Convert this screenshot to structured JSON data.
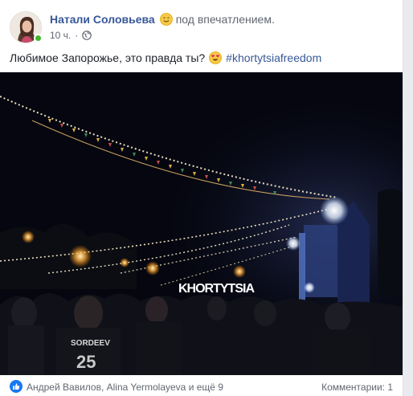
{
  "post": {
    "author": "Натали Соловьева",
    "feeling": "под впечатлением.",
    "time": "10 ч.",
    "separator": "·",
    "text": "Любимое Запорожье, это правда ты?",
    "hashtag": "#khortytsiafreedom",
    "photo_sign": "KHORTYTSIA"
  },
  "reactions": {
    "likes": "Андрей Вавилов, Alina Yermolayeva и ещё 9",
    "comments": "Комментарии: 1"
  },
  "colors": {
    "link": "#385898",
    "muted": "#616770",
    "online": "#42b72a",
    "like": "#1877f2"
  }
}
